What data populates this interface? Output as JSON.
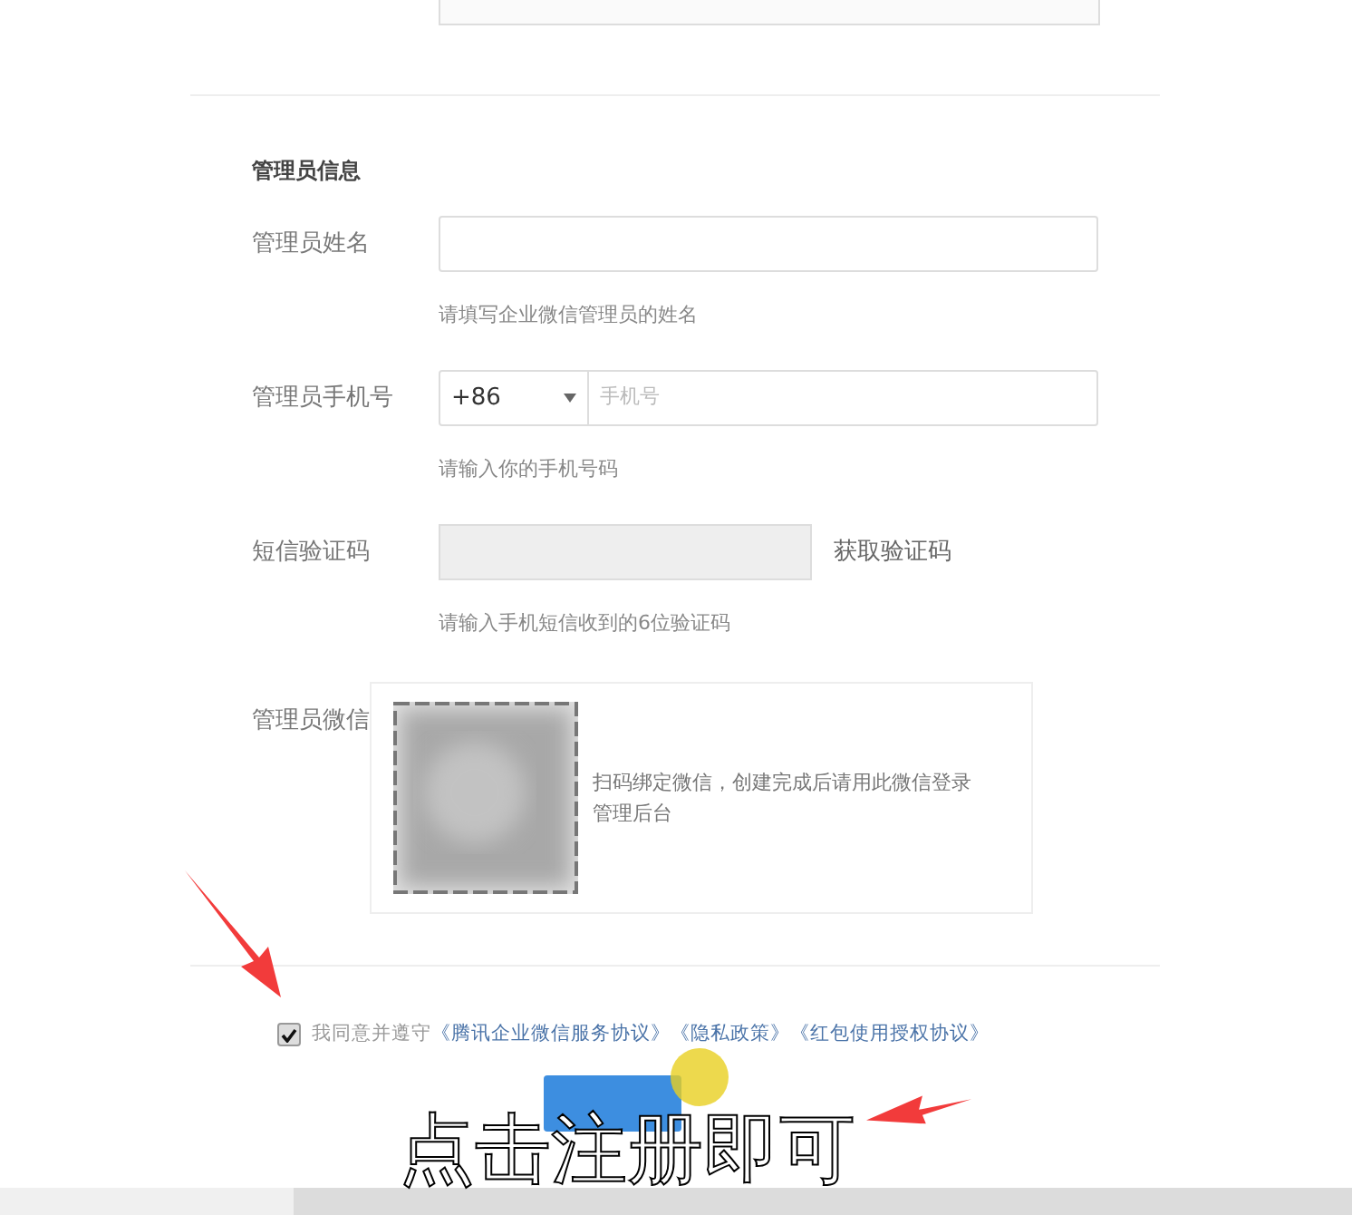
{
  "section_title": "管理员信息",
  "name_field": {
    "label": "管理员姓名",
    "hint": "请填写企业微信管理员的姓名"
  },
  "phone_field": {
    "label": "管理员手机号",
    "country_code": "+86",
    "placeholder": "手机号",
    "hint": "请输入你的手机号码"
  },
  "sms_field": {
    "label": "短信验证码",
    "disabled": true,
    "action": "获取验证码",
    "hint": "请输入手机短信收到的6位验证码"
  },
  "wechat_field": {
    "label": "管理员微信",
    "instruction": "扫码绑定微信，创建完成后请用此微信登录管理后台"
  },
  "agreement": {
    "checked": true,
    "text": "我同意并遵守",
    "links": [
      "《腾讯企业微信服务协议》",
      "《隐私政策》",
      "《红包使用授权协议》"
    ]
  },
  "subtitle": "点击注册即可"
}
